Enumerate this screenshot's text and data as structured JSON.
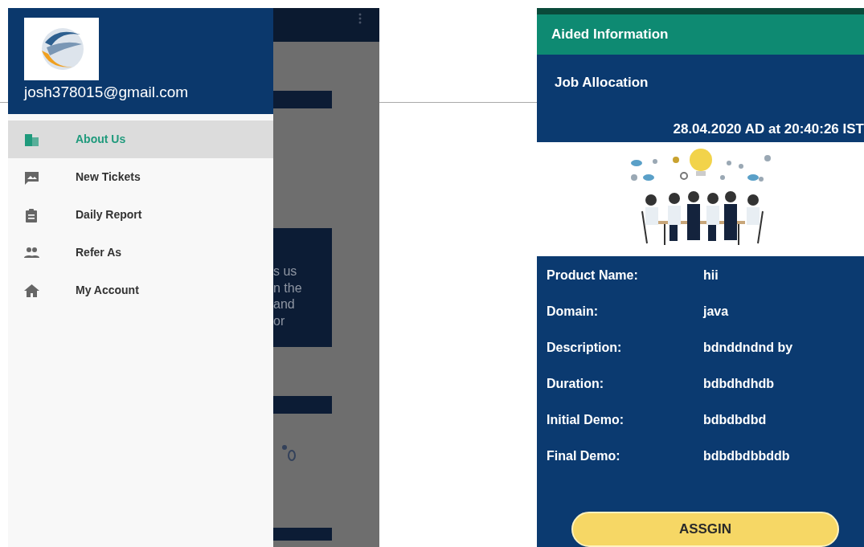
{
  "drawer": {
    "email": "josh378015@gmail.com",
    "items": [
      {
        "label": "About Us",
        "kind": "building",
        "selected": true
      },
      {
        "label": "New Tickets",
        "kind": "image",
        "selected": false
      },
      {
        "label": "Daily Report",
        "kind": "clipboard",
        "selected": false
      },
      {
        "label": "Refer As",
        "kind": "people",
        "selected": false
      },
      {
        "label": "My Account",
        "kind": "home",
        "selected": false
      }
    ]
  },
  "background_screen": {
    "text_fragments": [
      "s us",
      "n the",
      "and",
      "or"
    ]
  },
  "detail_screen": {
    "app_bar_title": "Aided Information",
    "section_title": "Job Allocation",
    "timestamp": "28.04.2020 AD at 20:40:26 IST",
    "fields": [
      {
        "label": "Product Name:",
        "value": "hii"
      },
      {
        "label": "Domain:",
        "value": "java"
      },
      {
        "label": "Description:",
        "value": "bdnddndnd by"
      },
      {
        "label": "Duration:",
        "value": "bdbdhdhdb"
      },
      {
        "label": "Initial Demo:",
        "value": "bdbdbdbd"
      },
      {
        "label": "Final Demo:",
        "value": "bdbdbdbbddb"
      }
    ],
    "button": "ASSGIN"
  }
}
